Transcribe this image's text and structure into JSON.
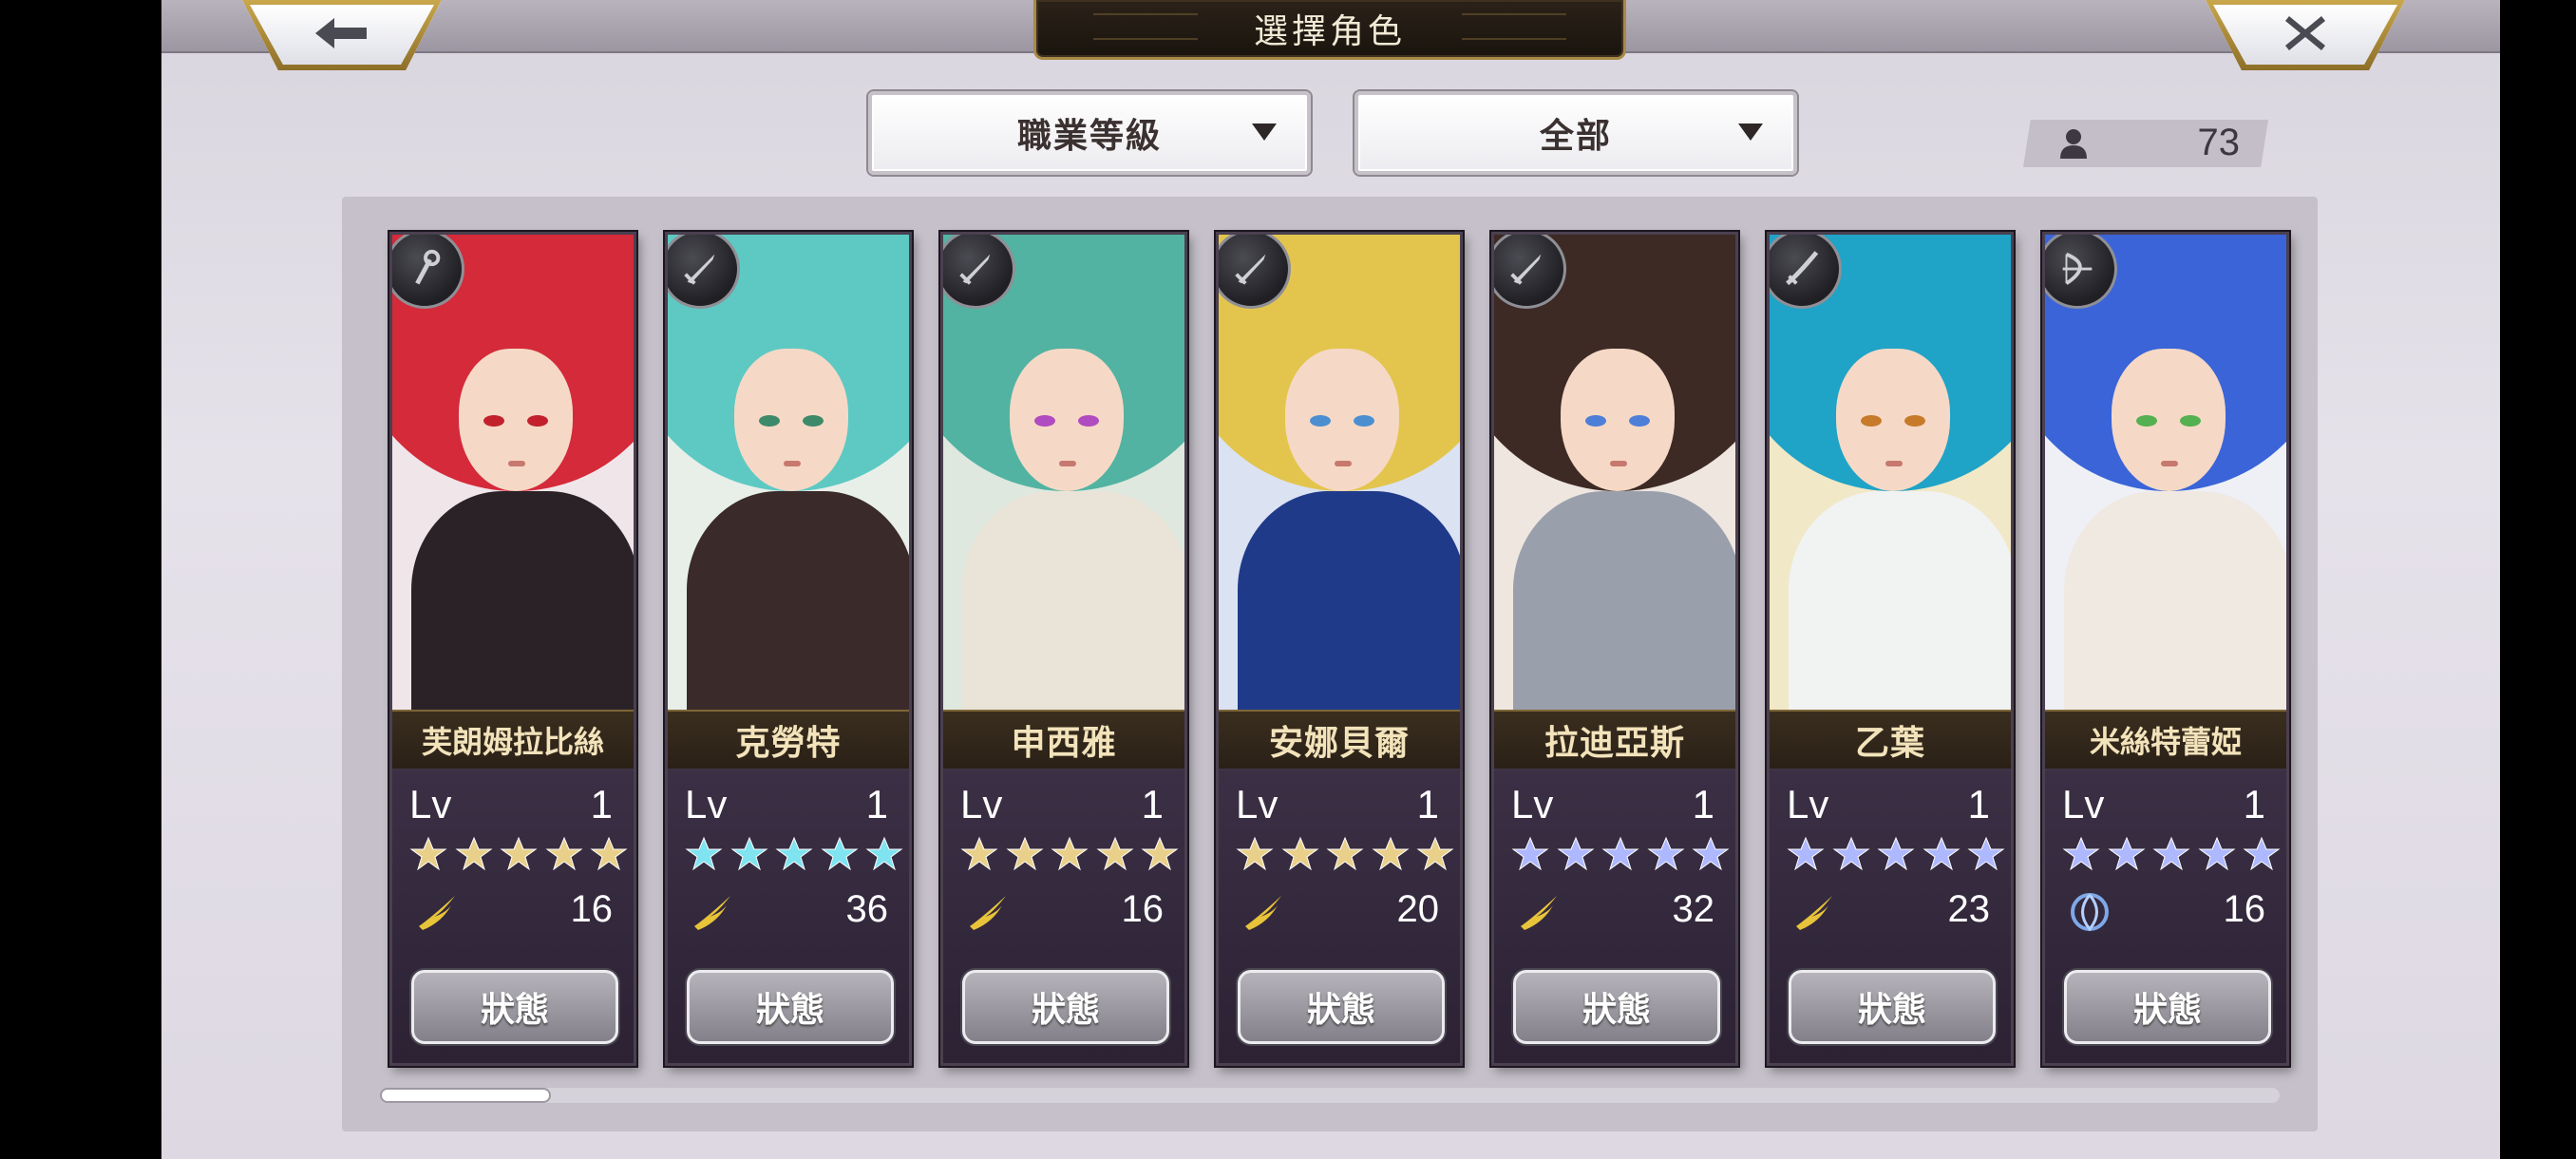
{
  "header": {
    "title": "選擇角色",
    "back_icon": "arrow-left-icon",
    "close_icon": "close-icon"
  },
  "filters": {
    "sort": "職業等級",
    "category": "全部"
  },
  "roster_count": "73",
  "characters": [
    {
      "name": "芙朗姆拉比絲",
      "lv_label": "Lv",
      "level": "1",
      "star_color": "#e9d08a",
      "element": "wind",
      "power": "16",
      "status": "狀態",
      "class_icon": "staff-icon"
    },
    {
      "name": "克勞特",
      "lv_label": "Lv",
      "level": "1",
      "star_color": "#7fe3f0",
      "element": "wind",
      "power": "36",
      "status": "狀態",
      "class_icon": "sword-icon"
    },
    {
      "name": "申西雅",
      "lv_label": "Lv",
      "level": "1",
      "star_color": "#e9d08a",
      "element": "wind",
      "power": "16",
      "status": "狀態",
      "class_icon": "sword-icon"
    },
    {
      "name": "安娜貝爾",
      "lv_label": "Lv",
      "level": "1",
      "star_color": "#e9d08a",
      "element": "wind",
      "power": "20",
      "status": "狀態",
      "class_icon": "sword-icon"
    },
    {
      "name": "拉迪亞斯",
      "lv_label": "Lv",
      "level": "1",
      "star_color": "#aeb8ff",
      "element": "wind",
      "power": "32",
      "status": "狀態",
      "class_icon": "sword-icon"
    },
    {
      "name": "乙葉",
      "lv_label": "Lv",
      "level": "1",
      "star_color": "#aeb8ff",
      "element": "wind",
      "power": "23",
      "status": "狀態",
      "class_icon": "katana-icon"
    },
    {
      "name": "米絲特蕾婭",
      "lv_label": "Lv",
      "level": "1",
      "star_color": "#aeb8ff",
      "element": "water",
      "power": "16",
      "status": "狀態",
      "class_icon": "bow-icon"
    }
  ]
}
